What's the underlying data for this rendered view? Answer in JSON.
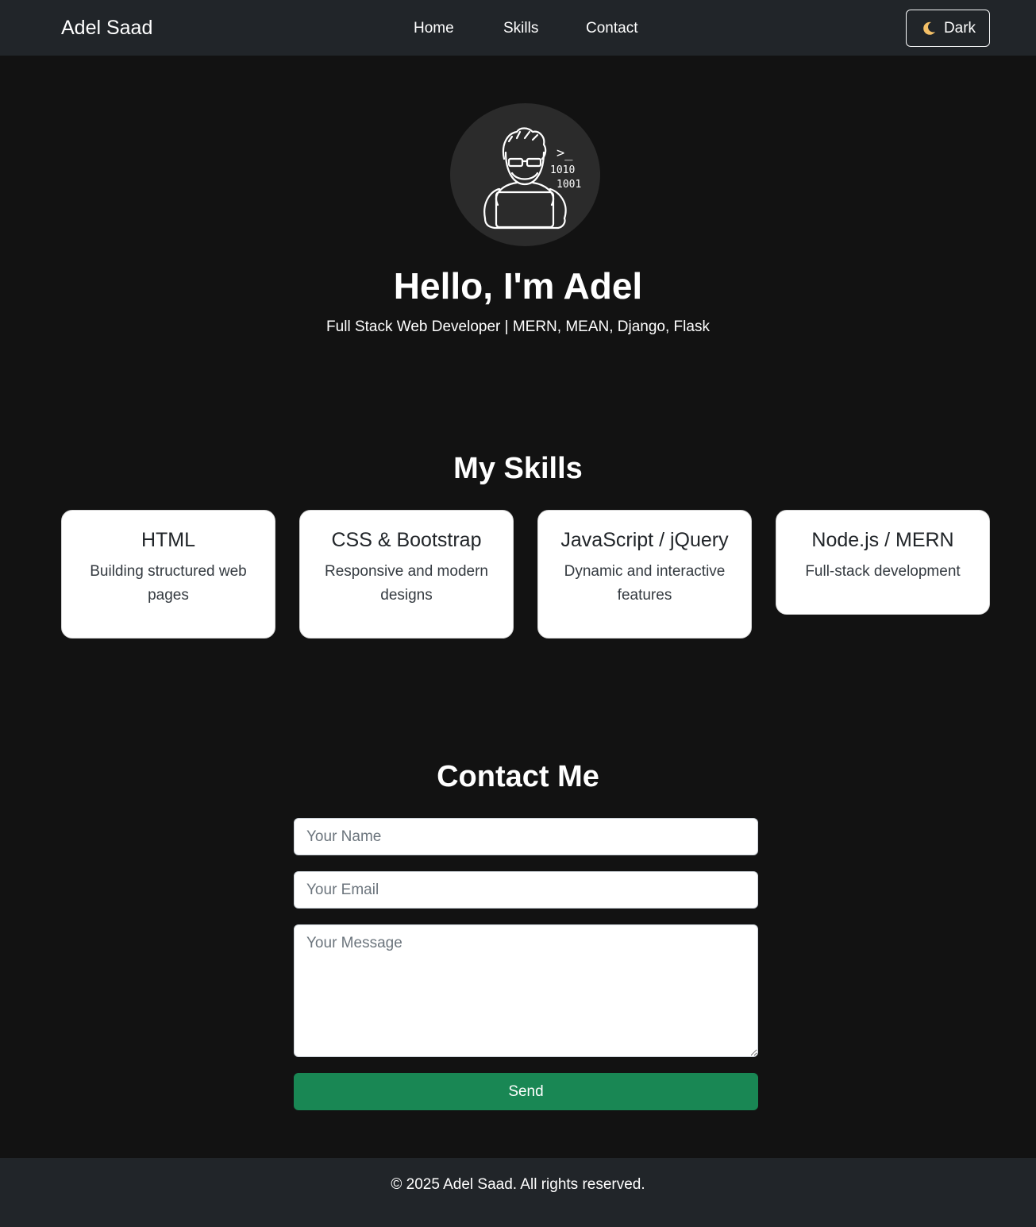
{
  "navbar": {
    "brand": "Adel Saad",
    "links": [
      {
        "label": "Home"
      },
      {
        "label": "Skills"
      },
      {
        "label": "Contact"
      }
    ],
    "theme_toggle": {
      "icon": "moon-icon",
      "label": "Dark"
    }
  },
  "hero": {
    "avatar_icon": "developer-avatar-icon",
    "avatar_text_1": ">_",
    "avatar_text_2": "1010",
    "avatar_text_3": "1001",
    "title": "Hello, I'm Adel",
    "subtitle": "Full Stack Web Developer | MERN, MEAN, Django, Flask"
  },
  "skills": {
    "title": "My Skills",
    "cards": [
      {
        "title": "HTML",
        "description": "Building structured web pages"
      },
      {
        "title": "CSS & Bootstrap",
        "description": "Responsive and modern designs"
      },
      {
        "title": "JavaScript / jQuery",
        "description": "Dynamic and interactive features"
      },
      {
        "title": "Node.js / MERN",
        "description": "Full-stack development"
      }
    ]
  },
  "contact": {
    "title": "Contact Me",
    "name_placeholder": "Your Name",
    "email_placeholder": "Your Email",
    "message_placeholder": "Your Message",
    "send_label": "Send"
  },
  "footer": {
    "text": "© 2025 Adel Saad. All rights reserved."
  },
  "colors": {
    "navbar_bg": "#212529",
    "page_bg": "#121212",
    "send_button": "#198754"
  }
}
